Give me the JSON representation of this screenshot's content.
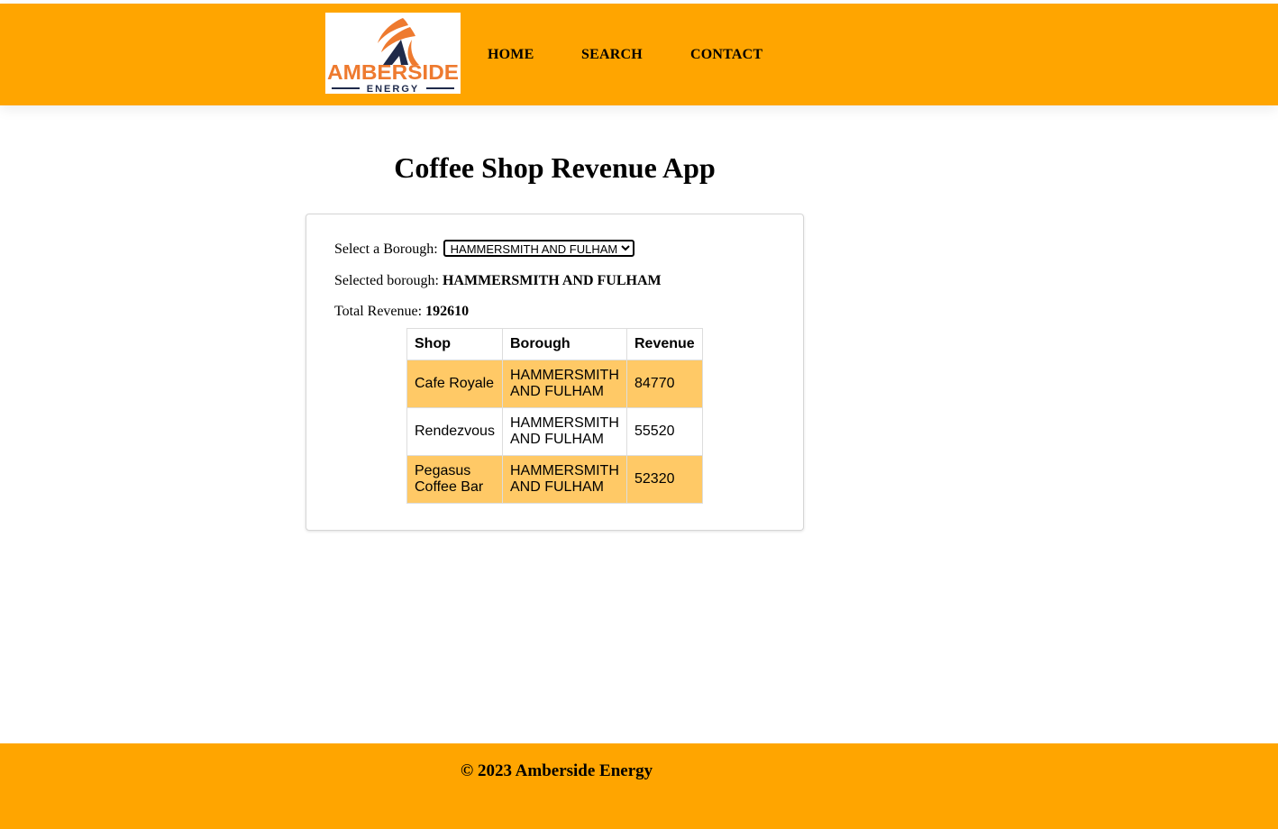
{
  "header": {
    "logo": {
      "text": "AMBERSIDE",
      "subtext": "ENERGY",
      "colors": {
        "orange": "#ee7a2f",
        "navy": "#1f2a4a"
      }
    },
    "nav": [
      {
        "label": "HOME"
      },
      {
        "label": "SEARCH"
      },
      {
        "label": "CONTACT"
      }
    ]
  },
  "main": {
    "title": "Coffee Shop Revenue App",
    "select_label": "Select a Borough:",
    "borough_select": {
      "selected": "HAMMERSMITH AND FULHAM",
      "options": [
        "HAMMERSMITH AND FULHAM"
      ]
    },
    "selected_label": "Selected borough:",
    "selected_value": "HAMMERSMITH AND FULHAM",
    "total_label": "Total Revenue:",
    "total_value": "192610",
    "table": {
      "headers": [
        "Shop",
        "Borough",
        "Revenue"
      ],
      "rows": [
        {
          "shop": "Cafe Royale",
          "borough": "HAMMERSMITH AND FULHAM",
          "revenue": "84770"
        },
        {
          "shop": "Rendezvous",
          "borough": "HAMMERSMITH AND FULHAM",
          "revenue": "55520"
        },
        {
          "shop": "Pegasus Coffee Bar",
          "borough": "HAMMERSMITH AND FULHAM",
          "revenue": "52320"
        }
      ]
    }
  },
  "footer": {
    "copyright": "© 2023 Amberside Energy"
  },
  "theme": {
    "header_bg": "#ffa500",
    "row_highlight": "#ffc966"
  }
}
